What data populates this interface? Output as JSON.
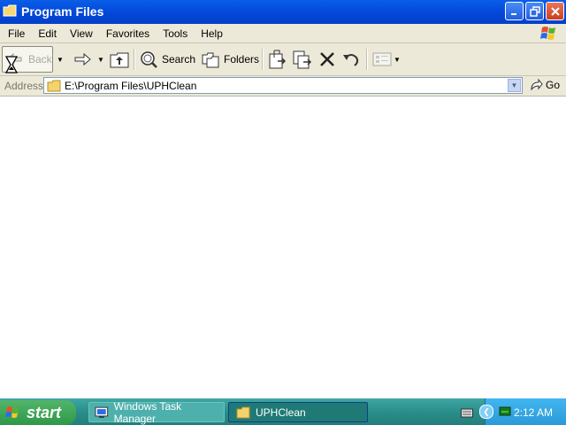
{
  "window": {
    "title": "Program Files",
    "controls": [
      "minimize",
      "maximize",
      "close"
    ]
  },
  "menu": {
    "items": [
      "File",
      "Edit",
      "View",
      "Favorites",
      "Tools",
      "Help"
    ]
  },
  "toolbar": {
    "back_label": "Back",
    "search_label": "Search",
    "folders_label": "Folders"
  },
  "address": {
    "label": "Address",
    "value": "E:\\Program Files\\UPHClean",
    "go_label": "Go"
  },
  "taskbar": {
    "start_label": "start",
    "tasks": [
      {
        "label": "Windows Task Manager"
      },
      {
        "label": "UPHClean"
      }
    ],
    "clock": "2:12 AM"
  },
  "colors": {
    "titlebar": "#0347d9",
    "taskbar": "#2a8e8a",
    "tray": "#2a9ad8",
    "start": "#2e9848"
  }
}
